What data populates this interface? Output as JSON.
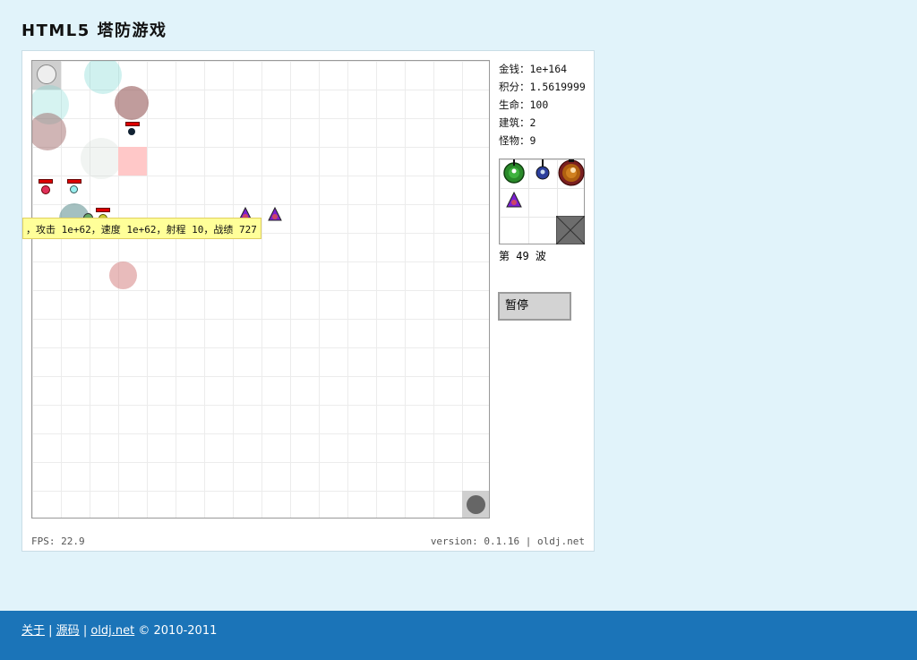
{
  "title": "HTML5 塔防游戏",
  "stats": {
    "money_label": "金钱：",
    "money": "1e+164",
    "score_label": "积分：",
    "score": "1.5619999",
    "life_label": "生命：",
    "life": "100",
    "buildings_label": "建筑：",
    "buildings": "2",
    "monsters_label": "怪物：",
    "monsters": "9"
  },
  "wave_text": "第 49 波",
  "pause_label": "暂停",
  "tooltip": "，攻击 1e+62，速度 1e+62，射程 10，战绩 727",
  "fps": "FPS: 22.9",
  "version": "version: 0.1.16 | oldj.net",
  "footer": {
    "about": "关于",
    "sep1": " | ",
    "source": "源码",
    "sep2": " | ",
    "site": "oldj.net",
    "copyright": " © 2010-2011"
  },
  "colors": {
    "page_bg": "#e1f3fa",
    "footer_bg": "#1b74b8",
    "tooltip_bg": "#ffff99"
  },
  "icons": {
    "shop_towers": [
      "green-cannon-tower-icon",
      "blue-laser-tower-icon",
      "orange-heavy-tower-icon",
      "purple-monster-icon",
      "blocked-cell-icon"
    ]
  }
}
